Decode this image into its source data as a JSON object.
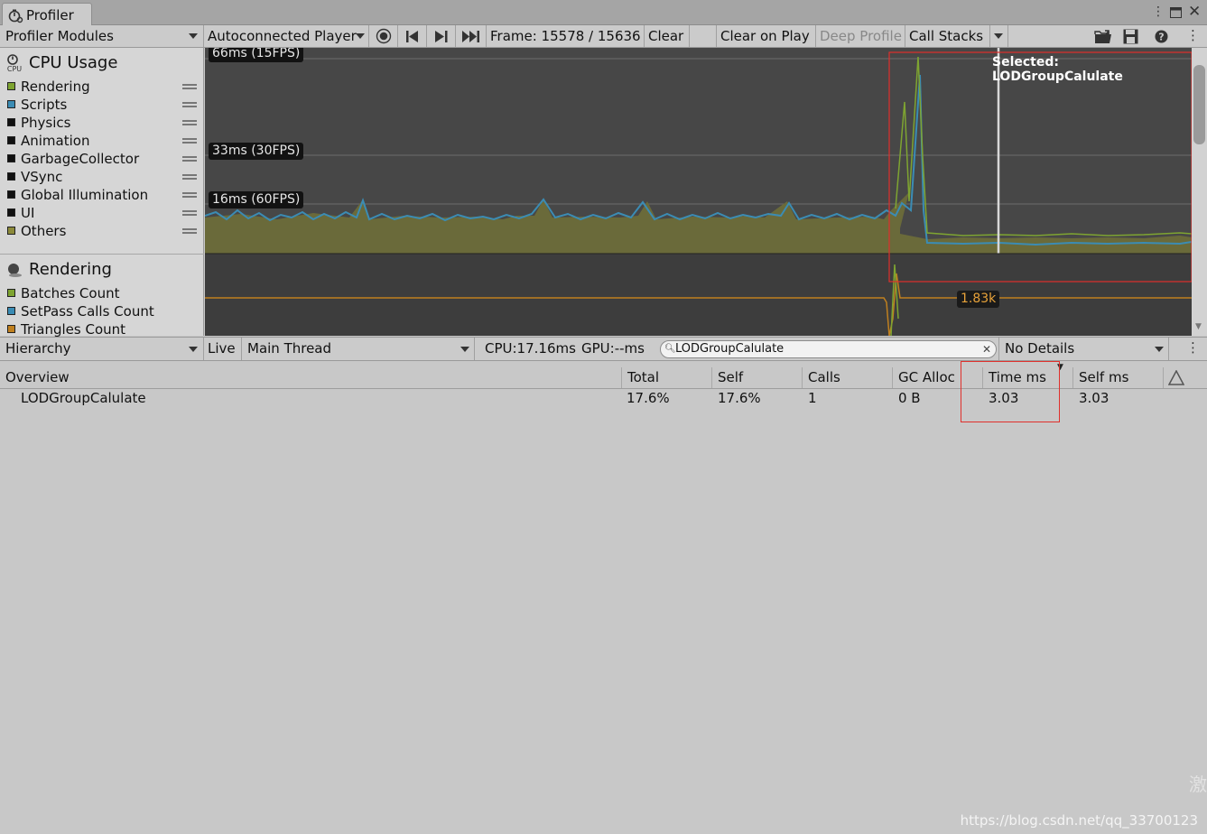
{
  "window": {
    "tab_title": "Profiler",
    "menu_icon": "kebab-menu-icon",
    "maximize_icon": "maximize-icon",
    "close_icon": "close-icon"
  },
  "toolbar": {
    "modules_label": "Profiler Modules",
    "player_label": "Autoconnected Player",
    "frame_label": "Frame: 15578 / 15636",
    "clear_label": "Clear",
    "clear_on_play_label": "Clear on Play",
    "deep_profile_label": "Deep Profile",
    "call_stacks_label": "Call Stacks"
  },
  "cpu_module": {
    "title": "CPU Usage",
    "icon_label": "CPU",
    "legend": [
      {
        "label": "Rendering",
        "color": "#7ea431"
      },
      {
        "label": "Scripts",
        "color": "#3b8cb4"
      },
      {
        "label": "Physics",
        "color": "#111111"
      },
      {
        "label": "Animation",
        "color": "#111111"
      },
      {
        "label": "GarbageCollector",
        "color": "#111111"
      },
      {
        "label": "VSync",
        "color": "#111111"
      },
      {
        "label": "Global Illumination",
        "color": "#111111"
      },
      {
        "label": "UI",
        "color": "#111111"
      },
      {
        "label": "Others",
        "color": "#8c8a3a"
      }
    ],
    "fps_66": "66ms (15FPS)",
    "fps_33": "33ms (30FPS)",
    "fps_16": "16ms (60FPS)",
    "selected_label": "Selected: LODGroupCalulate"
  },
  "rendering_module": {
    "title": "Rendering",
    "legend": [
      {
        "label": "Batches Count",
        "color": "#7ea431"
      },
      {
        "label": "SetPass Calls Count",
        "color": "#3b8cb4"
      },
      {
        "label": "Triangles Count",
        "color": "#c0801f"
      }
    ],
    "value_label": "1.83k"
  },
  "hierarchy_bar": {
    "view_label": "Hierarchy",
    "live_label": "Live",
    "thread_label": "Main Thread",
    "cpu_label": "CPU:17.16ms",
    "gpu_label": "GPU:--ms",
    "search_value": "LODGroupCalulate",
    "details_label": "No Details"
  },
  "table": {
    "columns": [
      "Overview",
      "Total",
      "Self",
      "Calls",
      "GC Alloc",
      "Time ms",
      "Self ms"
    ],
    "rows": [
      {
        "name": "LODGroupCalulate",
        "total": "17.6%",
        "self": "17.6%",
        "calls": "1",
        "gc_alloc": "0 B",
        "time_ms": "3.03",
        "self_ms": "3.03"
      }
    ]
  },
  "watermark": {
    "url": "https://blog.csdn.net/qq_33700123",
    "cjk": "激"
  },
  "colors": {
    "graph_bg": "#3b3b3b",
    "highlight_red": "#e0302c"
  }
}
